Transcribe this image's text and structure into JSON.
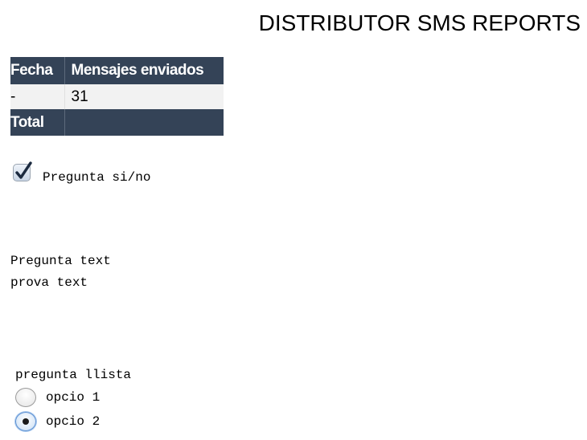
{
  "header": {
    "title": "DISTRIBUTOR SMS REPORTS"
  },
  "report_table": {
    "columns": [
      "Fecha",
      "Mensajes enviados"
    ],
    "rows": [
      {
        "fecha": "-",
        "mensajes": "31"
      }
    ],
    "footer": {
      "label": "Total",
      "value": ""
    },
    "colors": {
      "header_bg": "#344357",
      "header_text": "#ffffff",
      "row_bg": "#f2f2f2"
    }
  },
  "form": {
    "yes_no_question": {
      "label": "Pregunta si/no",
      "checked": true
    },
    "text_question": {
      "label": "Pregunta text",
      "value": "prova text"
    },
    "list_question": {
      "label": "pregunta llista",
      "options": [
        {
          "label": "opcio 1",
          "selected": false
        },
        {
          "label": "opcio 2",
          "selected": true
        }
      ]
    }
  },
  "icons": {
    "checkbox_mark": "checkmark-icon"
  }
}
